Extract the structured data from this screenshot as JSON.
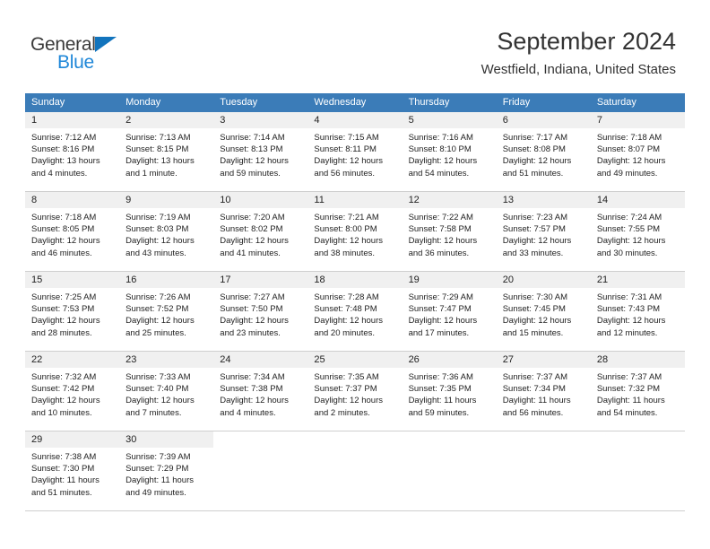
{
  "brand": {
    "name_top": "General",
    "name_bottom": "Blue",
    "color_dark": "#3a3a3a",
    "color_blue": "#1f87d8",
    "triangle_color": "#1274bd"
  },
  "header": {
    "title": "September 2024",
    "subtitle": "Westfield, Indiana, United States",
    "header_bg": "#3b7cb8",
    "daynum_band_bg": "#f0f0f0",
    "row_divider": "#cfcfcf"
  },
  "calendar": {
    "day_names": [
      "Sunday",
      "Monday",
      "Tuesday",
      "Wednesday",
      "Thursday",
      "Friday",
      "Saturday"
    ],
    "labels": {
      "sunrise": "Sunrise:",
      "sunset": "Sunset:",
      "daylight": "Daylight:"
    },
    "weeks": [
      [
        {
          "day": "1",
          "sunrise": "Sunrise: 7:12 AM",
          "sunset": "Sunset: 8:16 PM",
          "daylight_1": "Daylight: 13 hours",
          "daylight_2": "and 4 minutes."
        },
        {
          "day": "2",
          "sunrise": "Sunrise: 7:13 AM",
          "sunset": "Sunset: 8:15 PM",
          "daylight_1": "Daylight: 13 hours",
          "daylight_2": "and 1 minute."
        },
        {
          "day": "3",
          "sunrise": "Sunrise: 7:14 AM",
          "sunset": "Sunset: 8:13 PM",
          "daylight_1": "Daylight: 12 hours",
          "daylight_2": "and 59 minutes."
        },
        {
          "day": "4",
          "sunrise": "Sunrise: 7:15 AM",
          "sunset": "Sunset: 8:11 PM",
          "daylight_1": "Daylight: 12 hours",
          "daylight_2": "and 56 minutes."
        },
        {
          "day": "5",
          "sunrise": "Sunrise: 7:16 AM",
          "sunset": "Sunset: 8:10 PM",
          "daylight_1": "Daylight: 12 hours",
          "daylight_2": "and 54 minutes."
        },
        {
          "day": "6",
          "sunrise": "Sunrise: 7:17 AM",
          "sunset": "Sunset: 8:08 PM",
          "daylight_1": "Daylight: 12 hours",
          "daylight_2": "and 51 minutes."
        },
        {
          "day": "7",
          "sunrise": "Sunrise: 7:18 AM",
          "sunset": "Sunset: 8:07 PM",
          "daylight_1": "Daylight: 12 hours",
          "daylight_2": "and 49 minutes."
        }
      ],
      [
        {
          "day": "8",
          "sunrise": "Sunrise: 7:18 AM",
          "sunset": "Sunset: 8:05 PM",
          "daylight_1": "Daylight: 12 hours",
          "daylight_2": "and 46 minutes."
        },
        {
          "day": "9",
          "sunrise": "Sunrise: 7:19 AM",
          "sunset": "Sunset: 8:03 PM",
          "daylight_1": "Daylight: 12 hours",
          "daylight_2": "and 43 minutes."
        },
        {
          "day": "10",
          "sunrise": "Sunrise: 7:20 AM",
          "sunset": "Sunset: 8:02 PM",
          "daylight_1": "Daylight: 12 hours",
          "daylight_2": "and 41 minutes."
        },
        {
          "day": "11",
          "sunrise": "Sunrise: 7:21 AM",
          "sunset": "Sunset: 8:00 PM",
          "daylight_1": "Daylight: 12 hours",
          "daylight_2": "and 38 minutes."
        },
        {
          "day": "12",
          "sunrise": "Sunrise: 7:22 AM",
          "sunset": "Sunset: 7:58 PM",
          "daylight_1": "Daylight: 12 hours",
          "daylight_2": "and 36 minutes."
        },
        {
          "day": "13",
          "sunrise": "Sunrise: 7:23 AM",
          "sunset": "Sunset: 7:57 PM",
          "daylight_1": "Daylight: 12 hours",
          "daylight_2": "and 33 minutes."
        },
        {
          "day": "14",
          "sunrise": "Sunrise: 7:24 AM",
          "sunset": "Sunset: 7:55 PM",
          "daylight_1": "Daylight: 12 hours",
          "daylight_2": "and 30 minutes."
        }
      ],
      [
        {
          "day": "15",
          "sunrise": "Sunrise: 7:25 AM",
          "sunset": "Sunset: 7:53 PM",
          "daylight_1": "Daylight: 12 hours",
          "daylight_2": "and 28 minutes."
        },
        {
          "day": "16",
          "sunrise": "Sunrise: 7:26 AM",
          "sunset": "Sunset: 7:52 PM",
          "daylight_1": "Daylight: 12 hours",
          "daylight_2": "and 25 minutes."
        },
        {
          "day": "17",
          "sunrise": "Sunrise: 7:27 AM",
          "sunset": "Sunset: 7:50 PM",
          "daylight_1": "Daylight: 12 hours",
          "daylight_2": "and 23 minutes."
        },
        {
          "day": "18",
          "sunrise": "Sunrise: 7:28 AM",
          "sunset": "Sunset: 7:48 PM",
          "daylight_1": "Daylight: 12 hours",
          "daylight_2": "and 20 minutes."
        },
        {
          "day": "19",
          "sunrise": "Sunrise: 7:29 AM",
          "sunset": "Sunset: 7:47 PM",
          "daylight_1": "Daylight: 12 hours",
          "daylight_2": "and 17 minutes."
        },
        {
          "day": "20",
          "sunrise": "Sunrise: 7:30 AM",
          "sunset": "Sunset: 7:45 PM",
          "daylight_1": "Daylight: 12 hours",
          "daylight_2": "and 15 minutes."
        },
        {
          "day": "21",
          "sunrise": "Sunrise: 7:31 AM",
          "sunset": "Sunset: 7:43 PM",
          "daylight_1": "Daylight: 12 hours",
          "daylight_2": "and 12 minutes."
        }
      ],
      [
        {
          "day": "22",
          "sunrise": "Sunrise: 7:32 AM",
          "sunset": "Sunset: 7:42 PM",
          "daylight_1": "Daylight: 12 hours",
          "daylight_2": "and 10 minutes."
        },
        {
          "day": "23",
          "sunrise": "Sunrise: 7:33 AM",
          "sunset": "Sunset: 7:40 PM",
          "daylight_1": "Daylight: 12 hours",
          "daylight_2": "and 7 minutes."
        },
        {
          "day": "24",
          "sunrise": "Sunrise: 7:34 AM",
          "sunset": "Sunset: 7:38 PM",
          "daylight_1": "Daylight: 12 hours",
          "daylight_2": "and 4 minutes."
        },
        {
          "day": "25",
          "sunrise": "Sunrise: 7:35 AM",
          "sunset": "Sunset: 7:37 PM",
          "daylight_1": "Daylight: 12 hours",
          "daylight_2": "and 2 minutes."
        },
        {
          "day": "26",
          "sunrise": "Sunrise: 7:36 AM",
          "sunset": "Sunset: 7:35 PM",
          "daylight_1": "Daylight: 11 hours",
          "daylight_2": "and 59 minutes."
        },
        {
          "day": "27",
          "sunrise": "Sunrise: 7:37 AM",
          "sunset": "Sunset: 7:34 PM",
          "daylight_1": "Daylight: 11 hours",
          "daylight_2": "and 56 minutes."
        },
        {
          "day": "28",
          "sunrise": "Sunrise: 7:37 AM",
          "sunset": "Sunset: 7:32 PM",
          "daylight_1": "Daylight: 11 hours",
          "daylight_2": "and 54 minutes."
        }
      ],
      [
        {
          "day": "29",
          "sunrise": "Sunrise: 7:38 AM",
          "sunset": "Sunset: 7:30 PM",
          "daylight_1": "Daylight: 11 hours",
          "daylight_2": "and 51 minutes."
        },
        {
          "day": "30",
          "sunrise": "Sunrise: 7:39 AM",
          "sunset": "Sunset: 7:29 PM",
          "daylight_1": "Daylight: 11 hours",
          "daylight_2": "and 49 minutes."
        },
        {
          "day": "",
          "sunrise": "",
          "sunset": "",
          "daylight_1": "",
          "daylight_2": ""
        },
        {
          "day": "",
          "sunrise": "",
          "sunset": "",
          "daylight_1": "",
          "daylight_2": ""
        },
        {
          "day": "",
          "sunrise": "",
          "sunset": "",
          "daylight_1": "",
          "daylight_2": ""
        },
        {
          "day": "",
          "sunrise": "",
          "sunset": "",
          "daylight_1": "",
          "daylight_2": ""
        },
        {
          "day": "",
          "sunrise": "",
          "sunset": "",
          "daylight_1": "",
          "daylight_2": ""
        }
      ]
    ]
  }
}
